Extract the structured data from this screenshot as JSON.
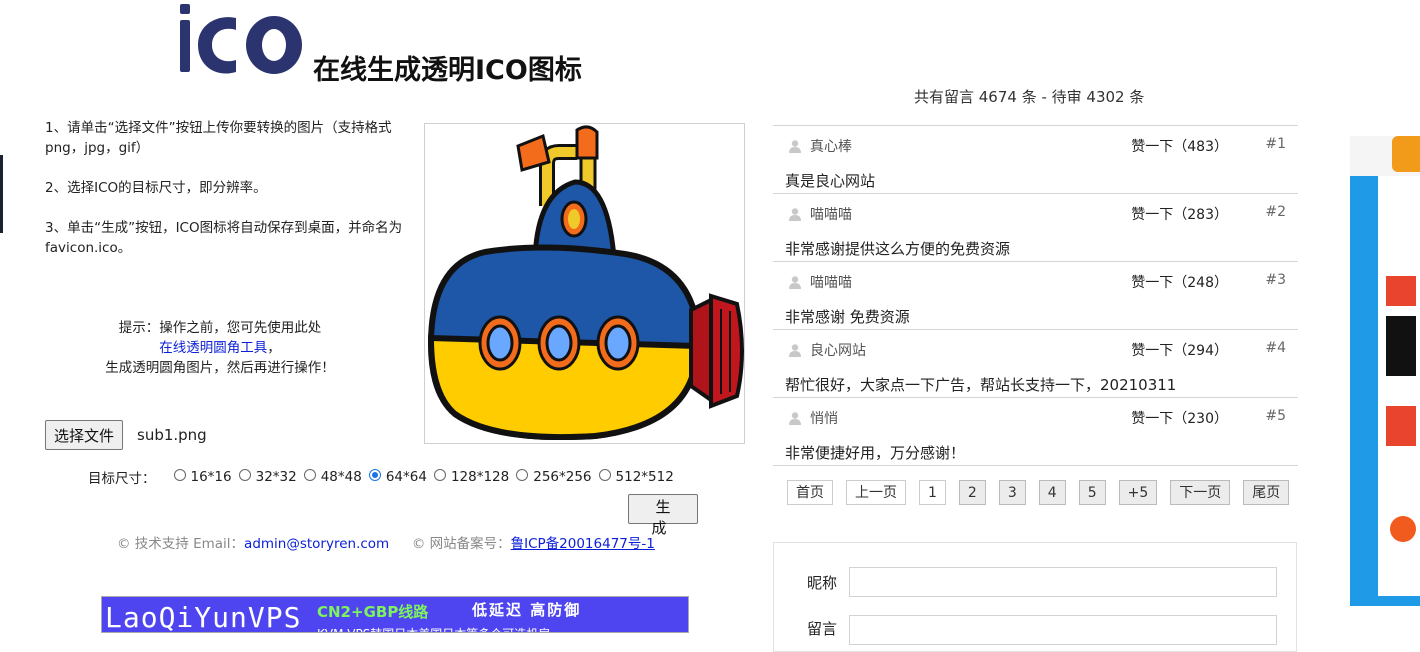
{
  "header": {
    "logo_text": "iCO",
    "title": "在线生成透明ICO图标",
    "message_count": "共有留言 4674 条 - 待审 4302 条"
  },
  "instructions": {
    "step1": "1、请单击“选择文件”按钮上传你要转换的图片（支持格式 png，jpg，gif）",
    "step2": "2、选择ICO的目标尺寸，即分辨率。",
    "step3": "3、单击“生成”按钮，ICO图标将自动保存到桌面，并命名为favicon.ico。",
    "tip_prefix": "提示：操作之前，您可先使用此处",
    "tip_link": "在线透明圆角工具",
    "tip_comma": "，",
    "tip_suffix": "生成透明圆角图片，然后再进行操作！"
  },
  "upload": {
    "choose_button": "选择文件",
    "file_name": "sub1.png"
  },
  "size": {
    "label": "目标尺寸：",
    "options": [
      "16*16",
      "32*32",
      "48*48",
      "64*64",
      "128*128",
      "256*256",
      "512*512"
    ],
    "selected": "64*64"
  },
  "generate_button": "生　成",
  "footer": {
    "support_label": "© 技术支持 Email：",
    "email": "admin@storyren.com",
    "icp_label": "© 网站备案号：",
    "icp": "鲁ICP备20016477号-1"
  },
  "banner": {
    "brand": "LaoQiYunVPS",
    "line_tag": "CN2+GBP线路",
    "slogan": "低延迟 高防御",
    "sub": "KVM VPS韩国日本美国日本等多个可选机房"
  },
  "comments": [
    {
      "user": "真心棒",
      "like": "赞一下（483）",
      "index": "#1",
      "text": "真是良心网站"
    },
    {
      "user": "喵喵喵",
      "like": "赞一下（283）",
      "index": "#2",
      "text": "非常感谢提供这么方便的免费资源"
    },
    {
      "user": "喵喵喵",
      "like": "赞一下（248）",
      "index": "#3",
      "text": "非常感谢 免费资源"
    },
    {
      "user": "良心网站",
      "like": "赞一下（294）",
      "index": "#4",
      "text": "帮忙很好，大家点一下广告，帮站长支持一下，20210311"
    },
    {
      "user": "悄悄",
      "like": "赞一下（230）",
      "index": "#5",
      "text": "非常便捷好用，万分感谢！"
    }
  ],
  "pagination": {
    "first": "首页",
    "prev": "上一页",
    "pages": [
      "1",
      "2",
      "3",
      "4",
      "5"
    ],
    "current": "1",
    "more": "+5",
    "next": "下一页",
    "last": "尾页"
  },
  "form": {
    "nickname_label": "昵称",
    "message_label": "留言"
  },
  "colors": {
    "link": "#0b1fd8",
    "banner_bg": "#4f45f0",
    "side_ad": "#1f9ae6"
  }
}
